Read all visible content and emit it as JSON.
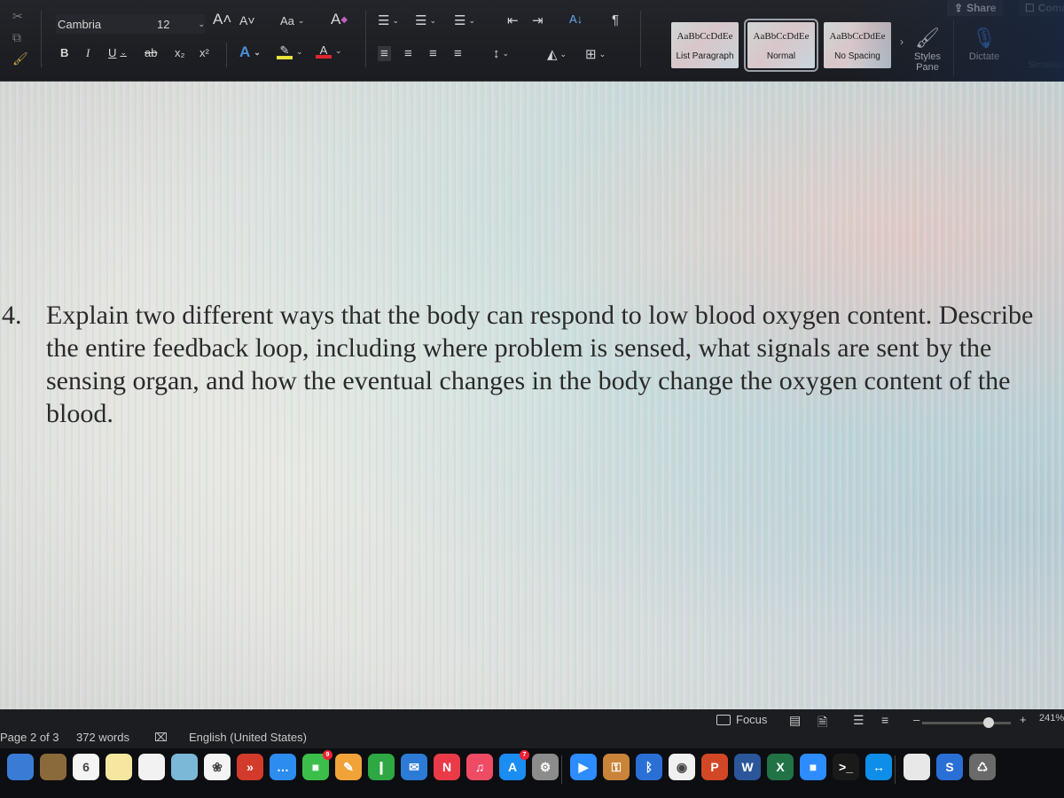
{
  "ribbon": {
    "font_name": "Cambria",
    "font_size": "12",
    "grow_font": "A˄",
    "shrink_font": "A˅",
    "change_case": "Aa",
    "clear_format": "A",
    "bold": "B",
    "italic": "I",
    "underline": "U",
    "strikethrough": "ab",
    "subscript": "x₂",
    "superscript": "x²",
    "text_effects": "A",
    "font_color": "A",
    "highlight_color": "#e8e23a",
    "font_color_bar": "#e0262d",
    "paragraph_icons": {
      "bullets": "☰",
      "numbering": "☰",
      "multilevel": "☰",
      "decrease_indent": "⇤",
      "increase_indent": "⇥",
      "sort": "A↓",
      "show_marks": "¶",
      "align_left": "≡",
      "align_center": "≡",
      "align_right": "≡",
      "justify": "≡",
      "line_spacing": "↕",
      "shading": "◭",
      "borders": "⊞"
    },
    "styles": [
      {
        "sample": "AaBbCcDdEe",
        "name": "List Paragraph",
        "active": false
      },
      {
        "sample": "AaBbCcDdEe",
        "name": "Normal",
        "active": true
      },
      {
        "sample": "AaBbCcDdEe",
        "name": "No Spacing",
        "active": false
      }
    ],
    "styles_pane": {
      "line1": "Styles",
      "line2": "Pane"
    },
    "dictate": "Dictate",
    "sensitivity": "Sensitivity",
    "share": "Share",
    "comments": "Comments"
  },
  "document": {
    "question_number": "4.",
    "question_text": "Explain two different ways that the body can respond to low blood oxygen content. Describe the entire feedback loop, including where problem is sensed, what signals are sent by the sensing organ, and how the eventual changes in the body change the oxygen content of the blood."
  },
  "statusbar": {
    "page": "Page 2 of 3",
    "words": "372 words",
    "proofing_icon": "⌧",
    "language": "English (United States)",
    "focus": "Focus",
    "zoom_minus": "–",
    "zoom_plus": "+",
    "zoom_level": "241%",
    "zoom_fraction": 0.75
  },
  "dock": {
    "calendar_day": "6",
    "facetime_badge": "9",
    "appstore_badge": "7",
    "apps": [
      {
        "name": "finder",
        "color": "#3a7bd5",
        "label": ""
      },
      {
        "name": "notes-folder",
        "color": "#8a6a3a",
        "label": ""
      },
      {
        "name": "calendar",
        "color": "#f4f4f4",
        "label": "6"
      },
      {
        "name": "notes",
        "color": "#f5e7a0",
        "label": ""
      },
      {
        "name": "reminders",
        "color": "#f2f2f2",
        "label": ""
      },
      {
        "name": "maps",
        "color": "#7bb8d8",
        "label": ""
      },
      {
        "name": "photos",
        "color": "#f4f4f4",
        "label": "❀"
      },
      {
        "name": "remote-desktop",
        "color": "#d23b2c",
        "label": "»"
      },
      {
        "name": "messages",
        "color": "#2d8cf0",
        "label": "…"
      },
      {
        "name": "facetime",
        "color": "#3cbf4a",
        "label": "■"
      },
      {
        "name": "pages",
        "color": "#f1a33a",
        "label": "✎"
      },
      {
        "name": "numbers",
        "color": "#2ea843",
        "label": "❙"
      },
      {
        "name": "keynote",
        "color": "#2d7bd6",
        "label": "✉"
      },
      {
        "name": "news",
        "color": "#ea3a48",
        "label": "N"
      },
      {
        "name": "music",
        "color": "#f04b65",
        "label": "♫"
      },
      {
        "name": "app-store",
        "color": "#1a8cf2",
        "label": "A"
      },
      {
        "name": "system-preferences",
        "color": "#8c8c8c",
        "label": "⚙"
      },
      {
        "name": "zoom-app",
        "color": "#2d8cff",
        "label": "▶"
      },
      {
        "name": "keychain",
        "color": "#c9843a",
        "label": "⚿"
      },
      {
        "name": "bluetooth",
        "color": "#2a6fd6",
        "label": "ᛒ"
      },
      {
        "name": "chrome",
        "color": "#f0f0f0",
        "label": "◉"
      },
      {
        "name": "powerpoint",
        "color": "#d24726",
        "label": "P"
      },
      {
        "name": "word",
        "color": "#2b579a",
        "label": "W"
      },
      {
        "name": "excel",
        "color": "#217346",
        "label": "X"
      },
      {
        "name": "zoom-meetings",
        "color": "#2d8cff",
        "label": "■"
      },
      {
        "name": "terminal",
        "color": "#1a1a1a",
        "label": ">_"
      },
      {
        "name": "teamviewer",
        "color": "#0e8ee9",
        "label": "↔"
      },
      {
        "name": "document-preview",
        "color": "#e8e8e8",
        "label": ""
      },
      {
        "name": "downloads",
        "color": "#2a6fd6",
        "label": "S"
      },
      {
        "name": "trash",
        "color": "#6a6a6a",
        "label": "♺"
      }
    ]
  }
}
